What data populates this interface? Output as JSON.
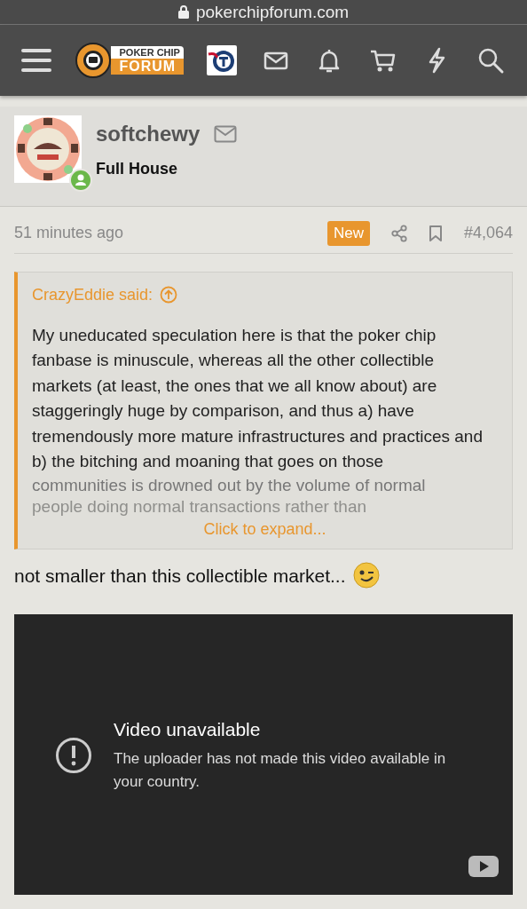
{
  "address_bar": {
    "url": "pokerchipforum.com"
  },
  "logo": {
    "line_1": "POKER CHIP",
    "line_2": "FORUM"
  },
  "post": {
    "author": "softchewy",
    "user_title": "Full House",
    "online": true,
    "time": "51 minutes ago",
    "new_badge": "New",
    "post_number": "#4,064",
    "quote": {
      "author": "CrazyEddie said:",
      "text": "My uneducated speculation here is that the poker chip fanbase is minuscule, whereas all the other collectible markets (at least, the ones that we all know about) are staggeringly huge by comparison, and thus a) have tremendously more mature infrastructures and practices and b) the bitching and moaning that goes on those",
      "faded_lines": [
        "communities is drowned out by the volume of normal",
        "people doing normal transactions rather than"
      ],
      "expand": "Click to expand..."
    },
    "message": "not smaller than this collectible market...",
    "video": {
      "title": "Video unavailable",
      "message": "The uploader has not made this video available in your country."
    }
  }
}
